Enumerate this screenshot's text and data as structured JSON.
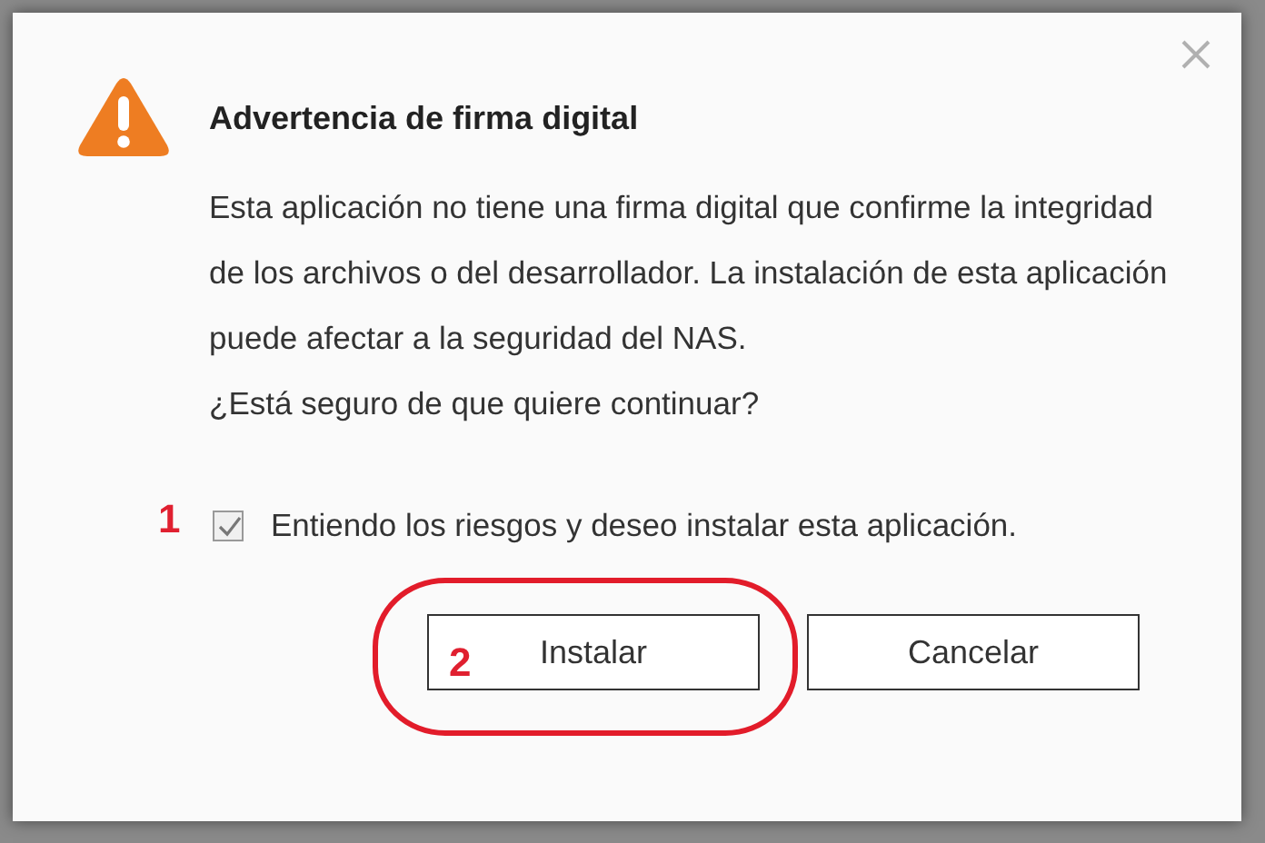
{
  "dialog": {
    "title": "Advertencia de firma digital",
    "message": "Esta aplicación no tiene una firma digital que confirme la integridad de los archivos o del desarrollador. La instalación de esta aplicación puede afectar a la seguridad del NAS.",
    "question": "¿Está seguro de que quiere continuar?",
    "checkbox": {
      "label": "Entiendo los riesgos y deseo instalar esta aplicación.",
      "checked": true
    },
    "buttons": [
      {
        "label": "Instalar",
        "highlighted": true
      },
      {
        "label": "Cancelar",
        "highlighted": false
      }
    ]
  },
  "annotations": [
    "1",
    "2"
  ]
}
